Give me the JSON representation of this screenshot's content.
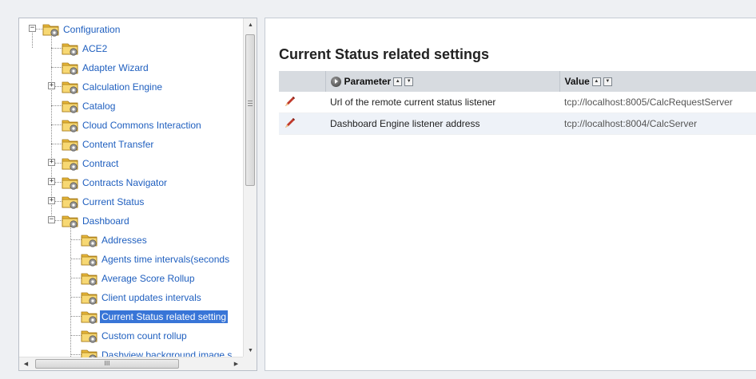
{
  "tree": {
    "items": [
      {
        "label": "Configuration",
        "level": 0,
        "expander": "minus"
      },
      {
        "label": "ACE2",
        "level": 1,
        "expander": "none"
      },
      {
        "label": "Adapter Wizard",
        "level": 1,
        "expander": "none"
      },
      {
        "label": "Calculation Engine",
        "level": 1,
        "expander": "plus"
      },
      {
        "label": "Catalog",
        "level": 1,
        "expander": "none"
      },
      {
        "label": "Cloud Commons Interaction",
        "level": 1,
        "expander": "none"
      },
      {
        "label": "Content Transfer",
        "level": 1,
        "expander": "none"
      },
      {
        "label": "Contract",
        "level": 1,
        "expander": "plus"
      },
      {
        "label": "Contracts Navigator",
        "level": 1,
        "expander": "plus"
      },
      {
        "label": "Current Status",
        "level": 1,
        "expander": "plus"
      },
      {
        "label": "Dashboard",
        "level": 1,
        "expander": "minus"
      },
      {
        "label": "Addresses",
        "level": 2,
        "expander": "none"
      },
      {
        "label": "Agents time intervals(seconds",
        "level": 2,
        "expander": "none"
      },
      {
        "label": "Average Score Rollup",
        "level": 2,
        "expander": "none"
      },
      {
        "label": "Client updates intervals",
        "level": 2,
        "expander": "none"
      },
      {
        "label": "Current Status related setting",
        "level": 2,
        "expander": "none",
        "selected": true
      },
      {
        "label": "Custom count rollup",
        "level": 2,
        "expander": "none"
      },
      {
        "label": "Dashview background image s",
        "level": 2,
        "expander": "none"
      }
    ],
    "hscroll_grip": "III"
  },
  "main": {
    "title": "Current Status related settings",
    "columns": {
      "parameter": "Parameter",
      "value": "Value"
    },
    "rows": [
      {
        "parameter": "Url of the remote current status listener",
        "value": "tcp://localhost:8005/CalcRequestServer"
      },
      {
        "parameter": "Dashboard Engine listener address",
        "value": "tcp://localhost:8004/CalcServer"
      }
    ]
  },
  "colors": {
    "tree_link": "#1f5fbf",
    "selection": "#3875d7",
    "header_bg": "#d7dbe0",
    "alt_row": "#eef2f8"
  },
  "icons": {
    "tree_node": "folder-gear-icon",
    "edit": "pencil-icon",
    "sort_asc": "sort-up-icon",
    "sort_desc": "sort-down-icon",
    "header_status": "circle-arrow-icon"
  }
}
